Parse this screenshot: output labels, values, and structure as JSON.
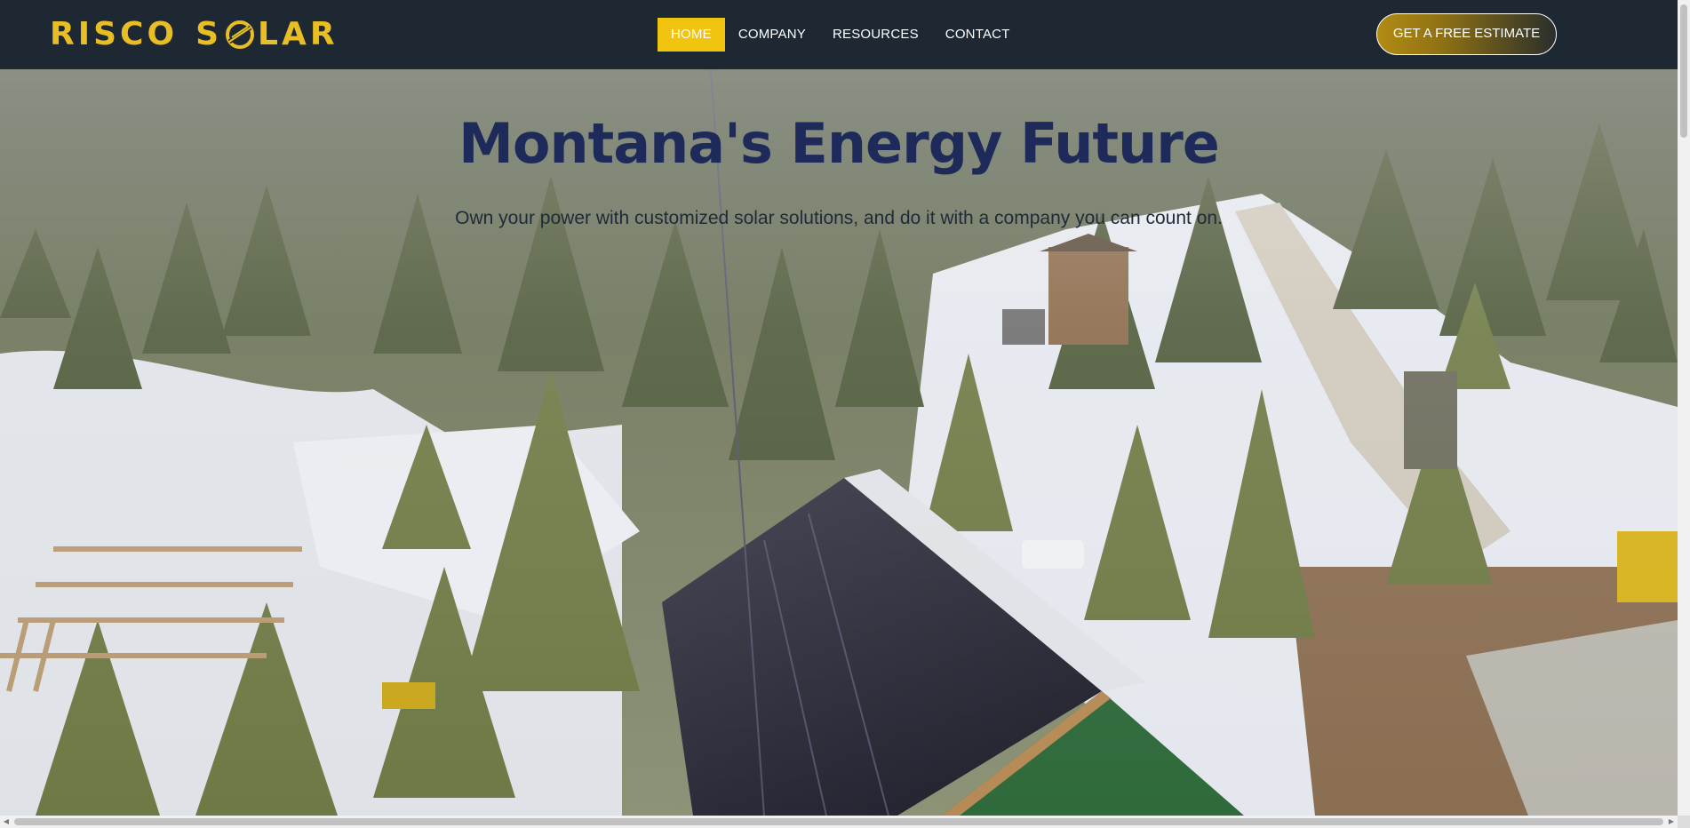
{
  "brand": {
    "logo_word1": "RISCO",
    "logo_word2_start": "S",
    "logo_word2_end": "LAR",
    "logo_full": "RISCO SOLAR",
    "accent": "#f1c40f",
    "logo_color": "#e8be24",
    "header_bg": "#1d2833",
    "title_color": "#1e2a5a"
  },
  "nav": {
    "items": [
      {
        "label": "HOME",
        "active": true
      },
      {
        "label": "COMPANY",
        "active": false
      },
      {
        "label": "RESOURCES",
        "active": false
      },
      {
        "label": "CONTACT",
        "active": false
      }
    ]
  },
  "cta": {
    "label": "GET A FREE ESTIMATE"
  },
  "hero": {
    "title": "Montana's Energy Future",
    "subtitle": "Own your power with customized solar solutions, and do it with a company you can count on."
  },
  "icons": {
    "logo_sun": "sun-icon",
    "scroll_up": "chevron-up-icon",
    "scroll_down": "chevron-down-icon",
    "scroll_left": "chevron-left-icon",
    "scroll_right": "chevron-right-icon"
  }
}
